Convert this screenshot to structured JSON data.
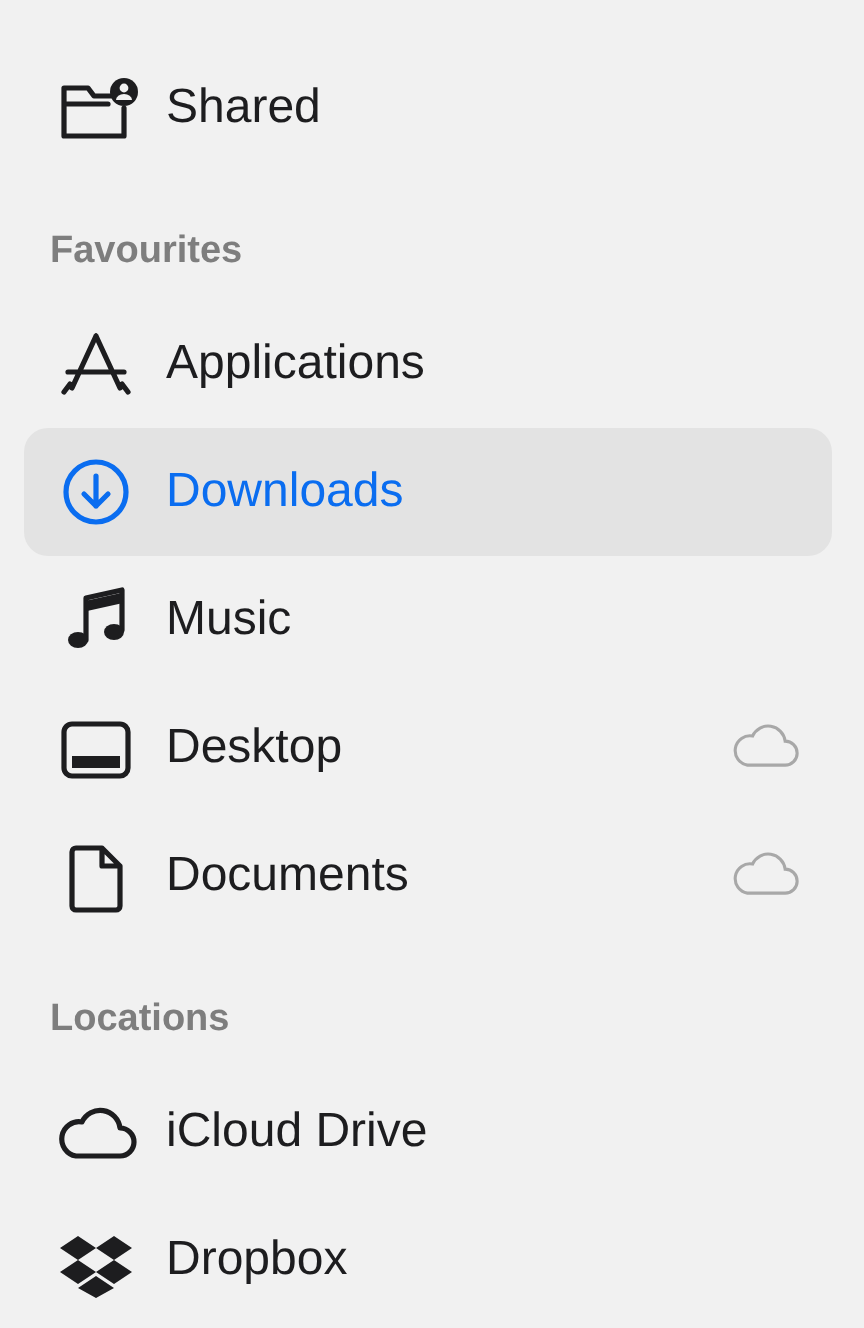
{
  "sections": [
    {
      "items": [
        {
          "kind": "shared",
          "label": "Shared",
          "selected": false,
          "in_cloud": false
        }
      ]
    },
    {
      "title": "Favourites",
      "items": [
        {
          "kind": "applications",
          "label": "Applications",
          "selected": false,
          "in_cloud": false
        },
        {
          "kind": "downloads",
          "label": "Downloads",
          "selected": true,
          "in_cloud": false
        },
        {
          "kind": "music",
          "label": "Music",
          "selected": false,
          "in_cloud": false
        },
        {
          "kind": "desktop",
          "label": "Desktop",
          "selected": false,
          "in_cloud": true
        },
        {
          "kind": "documents",
          "label": "Documents",
          "selected": false,
          "in_cloud": true
        }
      ]
    },
    {
      "title": "Locations",
      "items": [
        {
          "kind": "icloud",
          "label": "iCloud Drive",
          "selected": false,
          "in_cloud": false
        },
        {
          "kind": "dropbox",
          "label": "Dropbox",
          "selected": false,
          "in_cloud": false
        }
      ]
    }
  ]
}
